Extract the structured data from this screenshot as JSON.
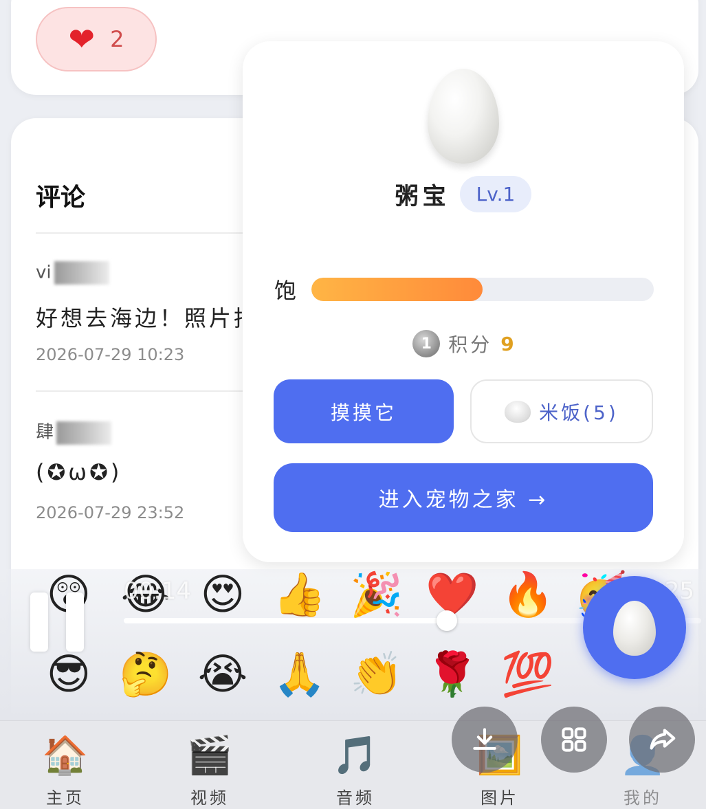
{
  "like": {
    "icon": "heart-icon",
    "count": "2"
  },
  "comments": {
    "title": "评论",
    "items": [
      {
        "author": "vi",
        "text": "好想去海边！照片拍",
        "time": "2026-07-29 10:23"
      },
      {
        "author": "肆",
        "text": "(✪ω✪)",
        "time": "2026-07-29 23:52"
      }
    ]
  },
  "pet": {
    "name": "粥宝",
    "level": "Lv.1",
    "hunger_label": "饱",
    "hunger_level": 0.5,
    "points_label": "积分",
    "points": "9",
    "coin_glyph": "1",
    "pet_button": "摸摸它",
    "rice_button": "米饭(5)",
    "enter_button": "进入宠物之家 →"
  },
  "emojis": {
    "row1": [
      "😲",
      "😂",
      "😍",
      "👍",
      "🎉",
      "❤️",
      "🔥",
      "🥳"
    ],
    "row2": [
      "😎",
      "🤔",
      "😭",
      "🙏",
      "👏",
      "🌹",
      "💯"
    ]
  },
  "video": {
    "current_time": "00:14",
    "total_time": "00:25",
    "progress": 0.56
  },
  "nav": [
    {
      "icon": "🏠",
      "label": "主页"
    },
    {
      "icon": "🎬",
      "label": "视频"
    },
    {
      "icon": "🎵",
      "label": "音频"
    },
    {
      "icon": "🖼️",
      "label": "图片"
    },
    {
      "icon": "👤",
      "label": "我的"
    }
  ],
  "actions": [
    "download-icon",
    "grid-icon",
    "share-icon"
  ],
  "colors": {
    "accent": "#4f6ef0",
    "hunger": "#ff9a3c",
    "points": "#e0a020",
    "like_bg": "#fde3e3"
  }
}
